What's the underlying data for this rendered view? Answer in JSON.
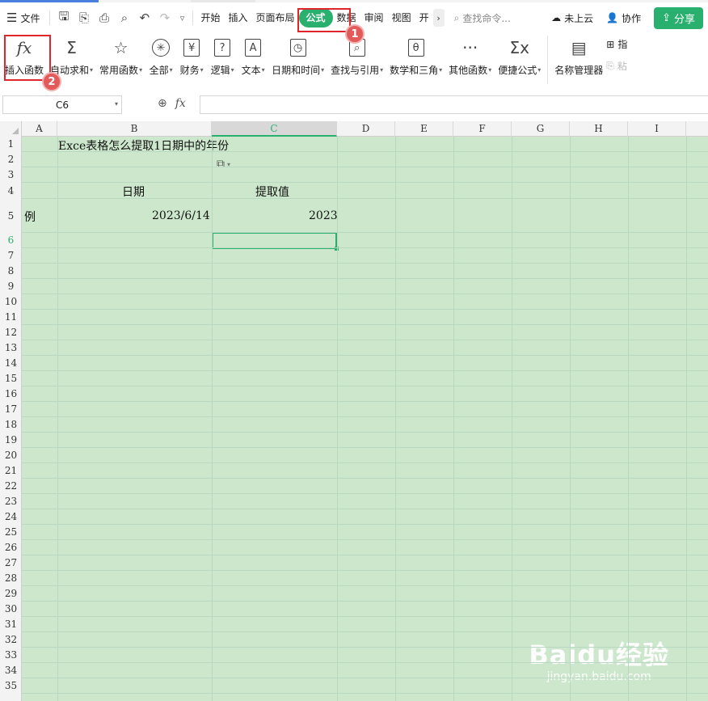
{
  "menubar": {
    "file_label": "文件",
    "tabs": [
      "开始",
      "插入",
      "页面布局",
      "公式",
      "数据",
      "审阅",
      "视图",
      "开"
    ],
    "active_tab": "公式",
    "search_placeholder": "查找命令...",
    "cloud_label": "未上云",
    "collab_label": "协作",
    "share_label": "分享"
  },
  "ribbon": {
    "items": [
      {
        "label": "插入函数",
        "icon": "fx-icon",
        "glyph": "fx"
      },
      {
        "label": "自动求和",
        "icon": "sigma-icon",
        "glyph": "Σ"
      },
      {
        "label": "常用函数",
        "icon": "star-icon",
        "glyph": "☆"
      },
      {
        "label": "全部",
        "icon": "asterisk-icon",
        "glyph": "✳"
      },
      {
        "label": "财务",
        "icon": "yen-icon",
        "glyph": "¥"
      },
      {
        "label": "逻辑",
        "icon": "question-icon",
        "glyph": "?"
      },
      {
        "label": "文本",
        "icon": "text-a-icon",
        "glyph": "A"
      },
      {
        "label": "日期和时间",
        "icon": "clock-icon",
        "glyph": "◷"
      },
      {
        "label": "查找与引用",
        "icon": "lookup-icon",
        "glyph": "⌕"
      },
      {
        "label": "数学和三角",
        "icon": "theta-icon",
        "glyph": "θ"
      },
      {
        "label": "其他函数",
        "icon": "more-icon",
        "glyph": "···"
      },
      {
        "label": "便捷公式",
        "icon": "quick-formula-icon",
        "glyph": "Σx"
      }
    ],
    "name_manager_label": "名称管理器",
    "right_stack": [
      "指",
      "粘"
    ]
  },
  "formula_bar": {
    "name_box": "C6",
    "fx_label": "fx",
    "value": ""
  },
  "columns": [
    "A",
    "B",
    "C",
    "D",
    "E",
    "F",
    "G",
    "H",
    "I"
  ],
  "selected_column": "C",
  "rows": [
    "1",
    "2",
    "3",
    "4",
    "5",
    "6",
    "7",
    "8",
    "9",
    "10",
    "11",
    "12",
    "13",
    "14",
    "15",
    "16",
    "17",
    "18",
    "19",
    "20",
    "21",
    "22",
    "23",
    "24",
    "25",
    "26",
    "27",
    "28",
    "29",
    "30",
    "31",
    "32",
    "33",
    "34",
    "35"
  ],
  "selected_row": "6",
  "cells": {
    "B1": "Exce表格怎么提取1日期中的年份",
    "B4": "日期",
    "C4": "提取值",
    "A5": "例",
    "B5": "2023/6/14",
    "C5": "2023"
  },
  "annotations": {
    "badge_1": "1",
    "badge_2": "2"
  },
  "watermark": {
    "logo": "Baidu经验",
    "url": "jingyan.baidu.com"
  },
  "colors": {
    "accent_green": "#2ab06e",
    "sheet_bg": "#cde7cd",
    "annotation_red": "#e0262a"
  }
}
